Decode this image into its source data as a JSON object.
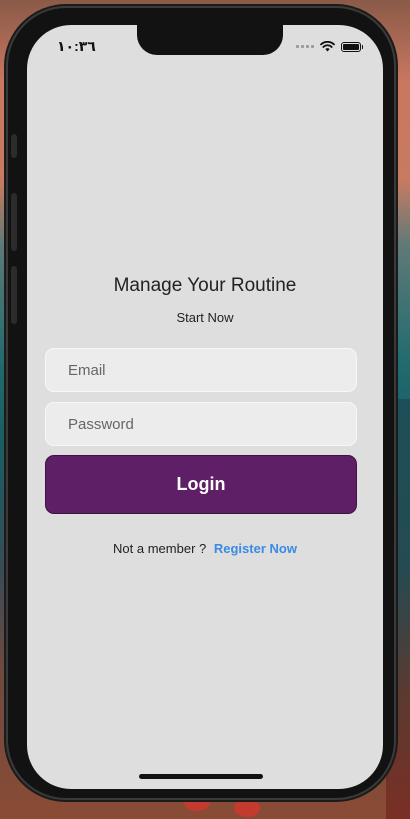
{
  "status_bar": {
    "time": "١٠:٣٦",
    "signal_icon": "signal-dots-icon",
    "wifi_icon": "wifi-icon",
    "battery_icon": "battery-icon"
  },
  "header": {
    "title": "Manage Your Routine",
    "subtitle": "Start Now"
  },
  "form": {
    "email_placeholder": "Email",
    "password_placeholder": "Password",
    "login_label": "Login"
  },
  "footer": {
    "prompt": "Not a member ?",
    "register_label": "Register Now"
  },
  "colors": {
    "login_button": "#5f1f66",
    "link": "#3a8ae6",
    "screen_bg": "#dedede"
  }
}
